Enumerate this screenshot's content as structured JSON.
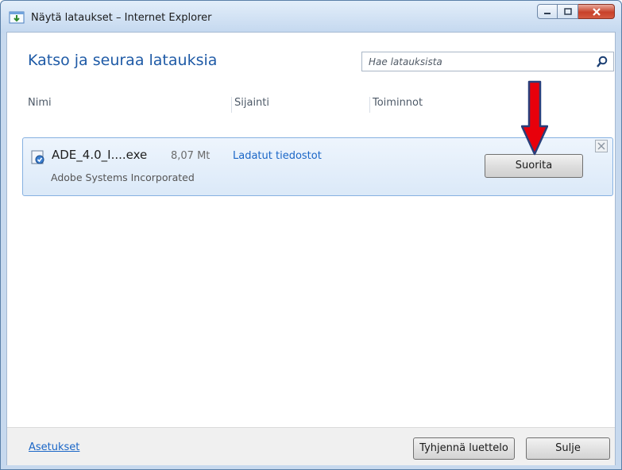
{
  "window": {
    "title": "Näytä lataukset – Internet Explorer",
    "colors": {
      "accent": "#1e5aa6",
      "link": "#1a66c7",
      "arrow": "#e8000b"
    }
  },
  "header": {
    "title": "Katso ja seuraa latauksia",
    "search_placeholder": "Hae latauksista"
  },
  "columns": [
    "Nimi",
    "Sijainti",
    "Toiminnot"
  ],
  "downloads": [
    {
      "name": "ADE_4.0_I....exe",
      "size": "8,07 Mt",
      "publisher": "Adobe Systems Incorporated",
      "location": "Ladatut tiedostot",
      "action": "Suorita"
    }
  ],
  "footer": {
    "settings": "Asetukset",
    "clear_label": "Tyhjennä luettelo",
    "close_label": "Sulje"
  }
}
